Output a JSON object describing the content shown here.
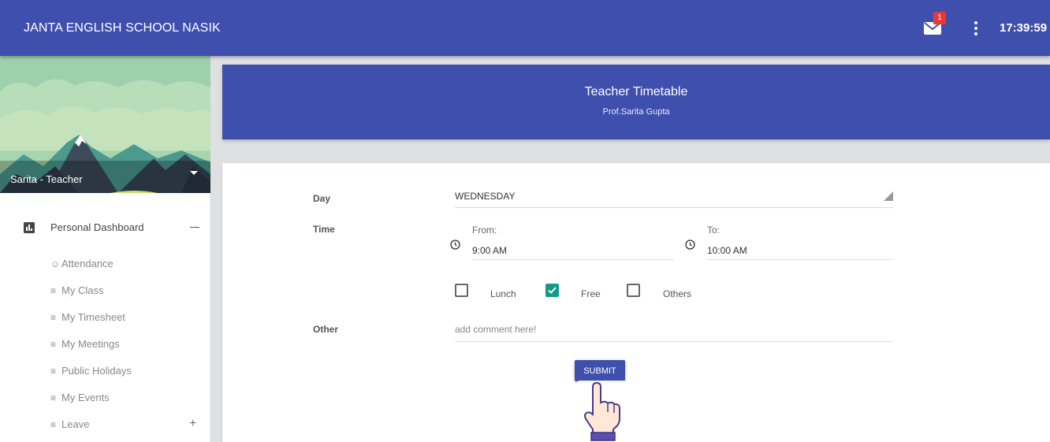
{
  "app": {
    "title": "JANTA ENGLISH SCHOOL NASIK",
    "clock": "17:39:59",
    "mail_badge": "1"
  },
  "colors": {
    "primary": "#3f4fae",
    "accent_check": "#16998a",
    "badge": "#e53935"
  },
  "sidebar": {
    "user": "Sarita - Teacher",
    "section": {
      "label": "Personal Dashboard",
      "icon": "bar-chart-icon",
      "state": "expanded"
    },
    "items": [
      {
        "label": "Attendance",
        "icon": "person-icon"
      },
      {
        "label": "My Class",
        "icon": "menu-lines-icon"
      },
      {
        "label": "My Timesheet",
        "icon": "menu-lines-icon"
      },
      {
        "label": "My Meetings",
        "icon": "menu-lines-icon"
      },
      {
        "label": "Public Holidays",
        "icon": "menu-lines-icon"
      },
      {
        "label": "My Events",
        "icon": "menu-lines-icon"
      },
      {
        "label": "Leave",
        "icon": "menu-lines-icon"
      }
    ]
  },
  "header": {
    "title": "Teacher Timetable",
    "subtitle": "Prof.Sarita Gupta"
  },
  "form": {
    "day_label": "Day",
    "day_value": "WEDNESDAY",
    "time_label": "Time",
    "from_caption": "From:",
    "from_value": "9:00 AM",
    "to_caption": "To:",
    "to_value": "10:00 AM",
    "options": [
      {
        "label": "Lunch",
        "checked": false
      },
      {
        "label": "Free",
        "checked": true
      },
      {
        "label": "Others",
        "checked": false
      }
    ],
    "other_label": "Other",
    "comment_placeholder": "add comment here!",
    "comment_value": "",
    "submit_label": "SUBMIT"
  }
}
